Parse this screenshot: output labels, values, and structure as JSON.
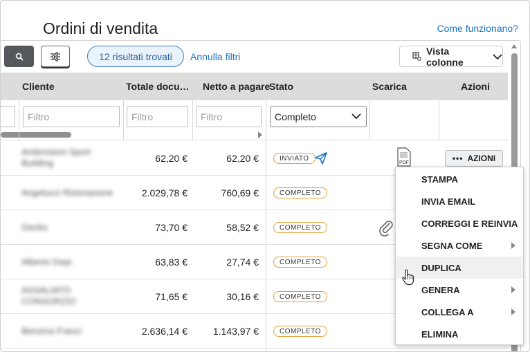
{
  "page": {
    "title": "Ordini di vendita",
    "help_link": "Come funzionano?"
  },
  "toolbar": {
    "results_pill": "12 risultati trovati",
    "reset_filters": "Annulla filtri",
    "columns_button": "Vista colonne"
  },
  "table": {
    "headers": {
      "client": "Cliente",
      "total": "Totale docu…",
      "net": "Netto a pagare",
      "status": "Stato",
      "download": "Scarica",
      "actions": "Azioni"
    },
    "filters": {
      "placeholder": "Filtro",
      "status_selected": "Completo"
    },
    "rows": [
      {
        "client": "Ambrosioni Sport Building",
        "total": "62,20 €",
        "net": "62,20 €",
        "status": "INVIATO"
      },
      {
        "client": "Angelucci Ristorazione",
        "total": "2.029,78 €",
        "net": "760,69 €",
        "status": "COMPLETO"
      },
      {
        "client": "Gecko",
        "total": "73,70 €",
        "net": "58,52 €",
        "status": "COMPLETO"
      },
      {
        "client": "Alberto Gepi",
        "total": "63,83 €",
        "net": "27,74 €",
        "status": "COMPLETO"
      },
      {
        "client": "ASSALIATO CONSORZIO",
        "total": "71,65 €",
        "net": "30,16 €",
        "status": "COMPLETO"
      },
      {
        "client": "Benzina Franci",
        "total": "2.636,14 €",
        "net": "1.143,97 €",
        "status": "COMPLETO"
      }
    ],
    "pdf_label": "PDF",
    "actions_button": "AZIONI"
  },
  "actions_menu": {
    "items": [
      {
        "label": "STAMPA",
        "submenu": false
      },
      {
        "label": "INVIA EMAIL",
        "submenu": false
      },
      {
        "label": "CORREGGI E REINVIA",
        "submenu": false
      },
      {
        "label": "SEGNA COME",
        "submenu": true
      },
      {
        "label": "DUPLICA",
        "submenu": false
      },
      {
        "label": "GENERA",
        "submenu": true
      },
      {
        "label": "COLLEGA A",
        "submenu": true
      },
      {
        "label": "ELIMINA",
        "submenu": false
      }
    ],
    "hovered": "DUPLICA"
  },
  "colors": {
    "accent": "#1a73c4",
    "badge_border": "#e0a030",
    "header_bg": "#dcdcdc"
  }
}
